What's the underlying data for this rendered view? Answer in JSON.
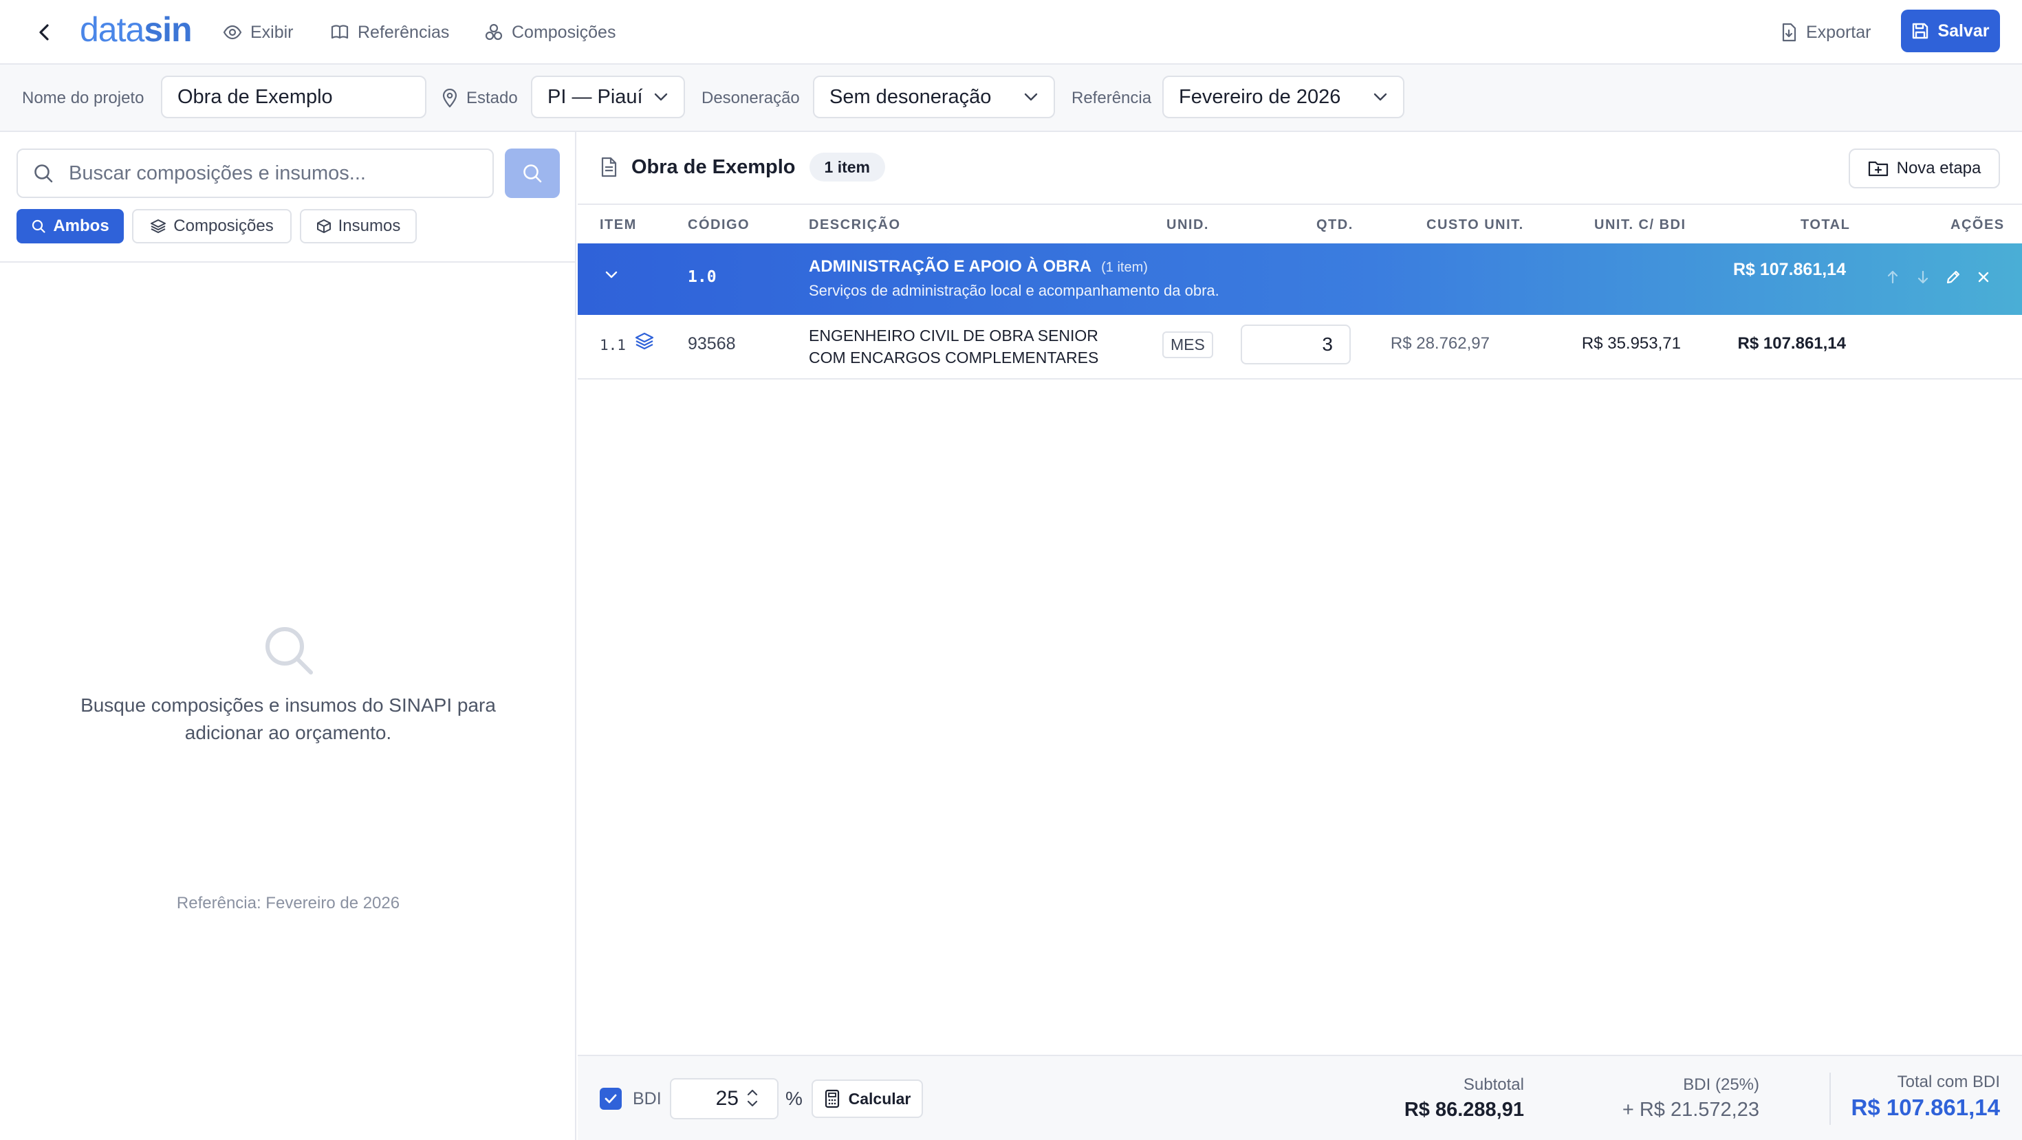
{
  "header": {
    "logo_text": "datasin",
    "nav": [
      {
        "label": "Exibir",
        "icon": "eye-icon"
      },
      {
        "label": "Referências",
        "icon": "book-icon"
      },
      {
        "label": "Composições",
        "icon": "components-icon"
      }
    ],
    "export_label": "Exportar",
    "save_label": "Salvar"
  },
  "project_bar": {
    "name_label": "Nome do projeto",
    "name_value": "Obra de Exemplo",
    "state_label": "Estado",
    "state_value": "PI — Piauí",
    "deson_label": "Desoneração",
    "deson_value": "Sem desoneração",
    "ref_label": "Referência",
    "ref_value": "Fevereiro de 2026"
  },
  "left_panel": {
    "search_placeholder": "Buscar composições e insumos...",
    "filters": [
      {
        "label": "Ambos",
        "active": true
      },
      {
        "label": "Composições",
        "active": false
      },
      {
        "label": "Insumos",
        "active": false
      }
    ],
    "empty_message": "Busque composições e insumos do SINAPI para adicionar ao orçamento.",
    "empty_reference": "Referência: Fevereiro de 2026"
  },
  "budget": {
    "title": "Obra de Exemplo",
    "badge": "1 item",
    "new_stage_label": "Nova etapa",
    "columns": {
      "item": "ITEM",
      "code": "CÓDIGO",
      "description": "DESCRIÇÃO",
      "unit": "UNID.",
      "qty": "QTD.",
      "unit_cost": "CUSTO UNIT.",
      "unit_bdi": "UNIT. C/ BDI",
      "total": "TOTAL",
      "actions": "AÇÕES"
    },
    "stage": {
      "code": "1.0",
      "title": "ADMINISTRAÇÃO E APOIO À OBRA",
      "count": "(1 item)",
      "description": "Serviços de administração local e acompanhamento da obra.",
      "total": "R$ 107.861,14"
    },
    "items": [
      {
        "number": "1.1",
        "code": "93568",
        "description": "ENGENHEIRO CIVIL DE OBRA SENIOR COM ENCARGOS COMPLEMENTARES",
        "unit": "MES",
        "qty": "3",
        "unit_cost": "R$ 28.762,97",
        "unit_bdi": "R$ 35.953,71",
        "total": "R$ 107.861,14"
      }
    ]
  },
  "footer": {
    "bdi_label": "BDI",
    "bdi_value": "25",
    "bdi_checked": true,
    "percent": "%",
    "calc_label": "Calcular",
    "subtotal_label": "Subtotal",
    "subtotal_value": "R$ 86.288,91",
    "bdi_amount_label": "BDI (25%)",
    "bdi_amount_value": "+ R$ 21.572,23",
    "grand_total_label": "Total com BDI",
    "grand_total_value": "R$ 107.861,14"
  },
  "colors": {
    "primary": "#2f62d9",
    "logo": "#4a86e8",
    "stage_gradient_start": "#2f62d9",
    "stage_gradient_end": "#4aaed6",
    "border": "#e6e8ee",
    "muted_text": "#5d6577"
  }
}
